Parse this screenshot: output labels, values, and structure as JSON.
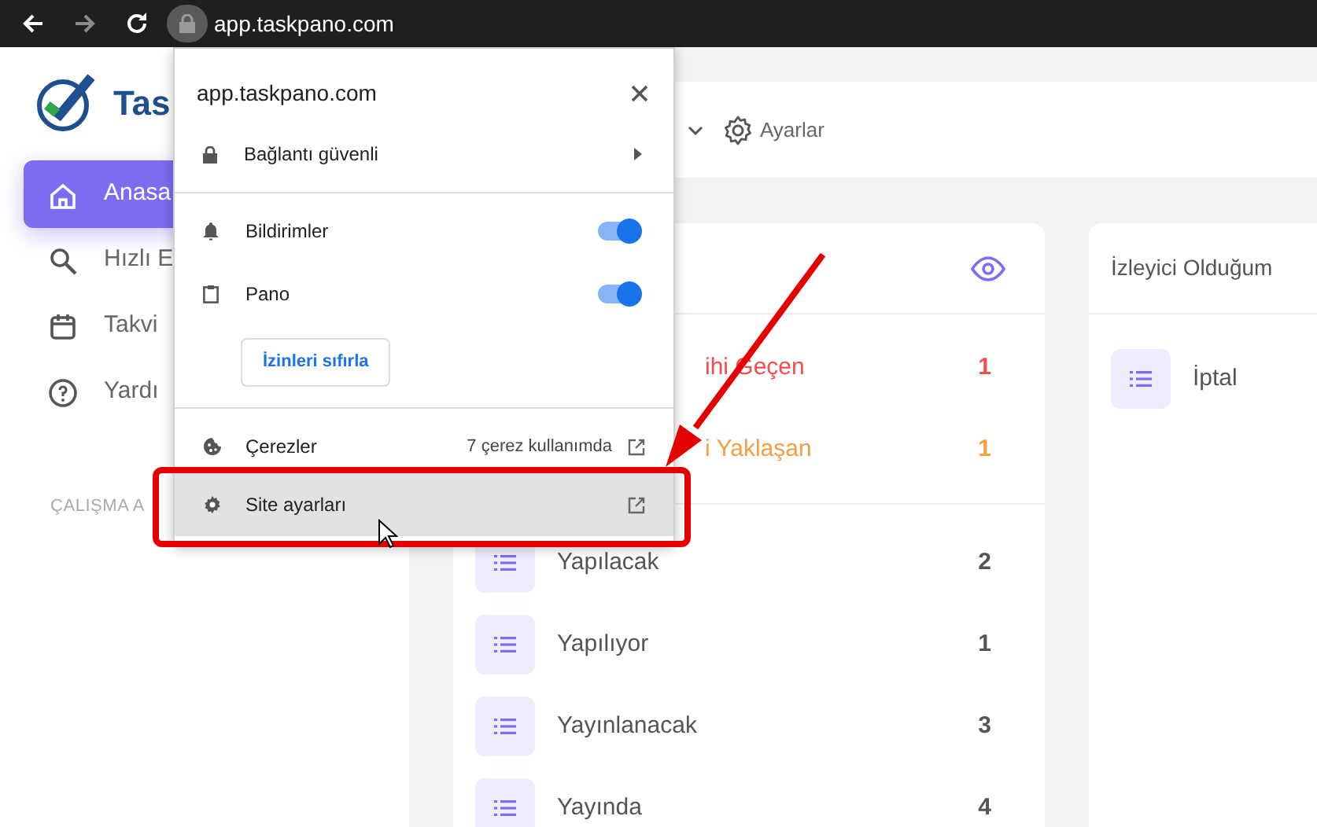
{
  "browser": {
    "url": "app.taskpano.com",
    "forward_disabled": true
  },
  "sidebar": {
    "logo_text": "Tas",
    "nav": [
      {
        "label": "Anasa",
        "selected": true
      },
      {
        "label": "Hızlı E",
        "selected": false
      },
      {
        "label": "Takvi",
        "selected": false
      },
      {
        "label": "Yardı",
        "selected": false
      }
    ],
    "section_title": "ÇALIŞMA A"
  },
  "header": {
    "settings_label": "Ayarlar"
  },
  "cards": [
    {
      "due_rows": [
        {
          "label": "ihi Geçen",
          "count": "1",
          "color": "#ef4f4f"
        },
        {
          "label": "i Yaklaşan",
          "count": "1",
          "color": "#f59e42"
        }
      ],
      "list_rows": [
        {
          "label": "Yapılacak",
          "count": "2"
        },
        {
          "label": "Yapılıyor",
          "count": "1"
        },
        {
          "label": "Yayınlanacak",
          "count": "3"
        },
        {
          "label": "Yayında",
          "count": "4"
        }
      ]
    },
    {
      "title": "İzleyici Olduğum",
      "list_rows": [
        {
          "label": "İptal"
        }
      ]
    }
  ],
  "site_popup": {
    "title": "app.taskpano.com",
    "connection": "Bağlantı güvenli",
    "permissions": [
      {
        "label": "Bildirimler",
        "on": true
      },
      {
        "label": "Pano",
        "on": true
      }
    ],
    "reset_button": "İzinleri sıfırla",
    "links": [
      {
        "label": "Çerezler",
        "detail": "7 çerez kullanımda",
        "selected": false
      },
      {
        "label": "Site ayarları",
        "selected": true
      }
    ]
  }
}
